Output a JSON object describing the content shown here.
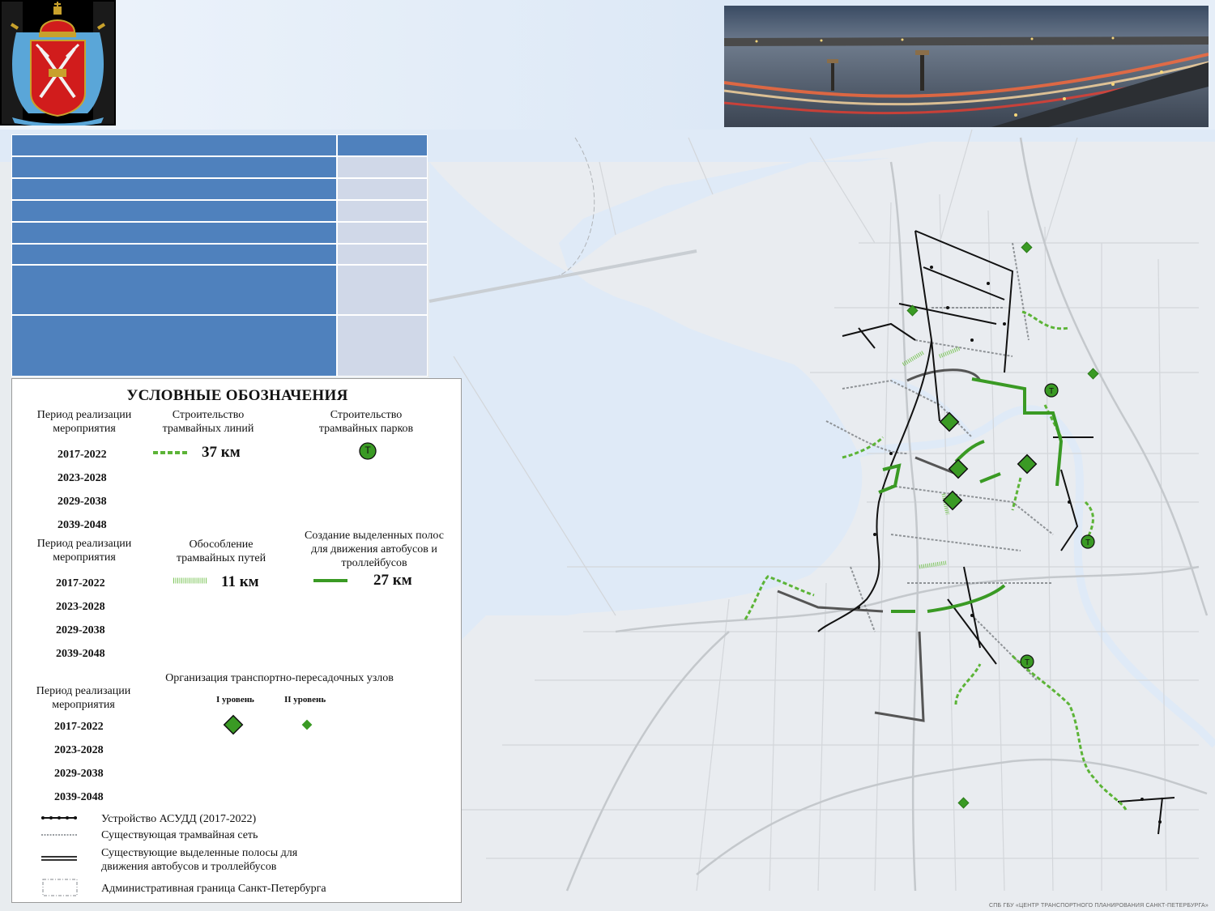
{
  "colors": {
    "accent_green": "#3a9a24",
    "table_header_blue": "#4f81bd",
    "table_cell_light": "#d0d8e8",
    "water": "#dfeaf7",
    "land": "#e9ecf0",
    "asudd": "#111111"
  },
  "header": {
    "coat_of_arms_icon": "coat-of-arms-icon",
    "photo_icon": "city-bridge-photo"
  },
  "table": {
    "rows": [
      {
        "c1": "",
        "c2": ""
      },
      {
        "c1": "",
        "c2": ""
      },
      {
        "c1": "",
        "c2": ""
      },
      {
        "c1": "",
        "c2": ""
      },
      {
        "c1": "",
        "c2": ""
      },
      {
        "c1": "",
        "c2": ""
      },
      {
        "c1": "",
        "c2": ""
      },
      {
        "c1": "",
        "c2": ""
      }
    ]
  },
  "legend": {
    "title": "УСЛОВНЫЕ ОБОЗНАЧЕНИЯ",
    "section1": {
      "period_header": "Период реализации мероприятия",
      "years": [
        "2017-2022",
        "2023-2028",
        "2029-2038",
        "2039-2048"
      ],
      "tram_lines_header": "Строительство трамвайных линий",
      "tram_lines_value": "37 км",
      "tram_parks_header": "Строительство трамвайных парков",
      "tram_park_symbol": "Т"
    },
    "section2": {
      "period_header": "Период реализации мероприятия",
      "years": [
        "2017-2022",
        "2023-2028",
        "2029-2038",
        "2039-2048"
      ],
      "tram_isolation_header": "Обособление трамвайных путей",
      "tram_isolation_value": "11 км",
      "bus_lanes_header": "Создание выделенных полос для движения автобусов и троллейбусов",
      "bus_lanes_value": "27 км"
    },
    "section3": {
      "period_header": "Период реализации мероприятия",
      "years": [
        "2017-2022",
        "2023-2028",
        "2029-2038",
        "2039-2048"
      ],
      "hubs_header": "Организация транспортно-пересадочных узлов",
      "level1": "I уровень",
      "level2": "II уровень"
    },
    "items": [
      "Устройство АСУДД (2017-2022)",
      "Существующая трамвайная сеть",
      "Существующие выделенные полосы для движения автобусов и троллейбусов",
      "Административная граница Санкт-Петербурга"
    ]
  },
  "map": {
    "tram_park_label": "Т"
  },
  "credit": "СПБ ГБУ «ЦЕНТР ТРАНСПОРТНОГО ПЛАНИРОВАНИЯ САНКТ-ПЕТЕРБУРГА»"
}
